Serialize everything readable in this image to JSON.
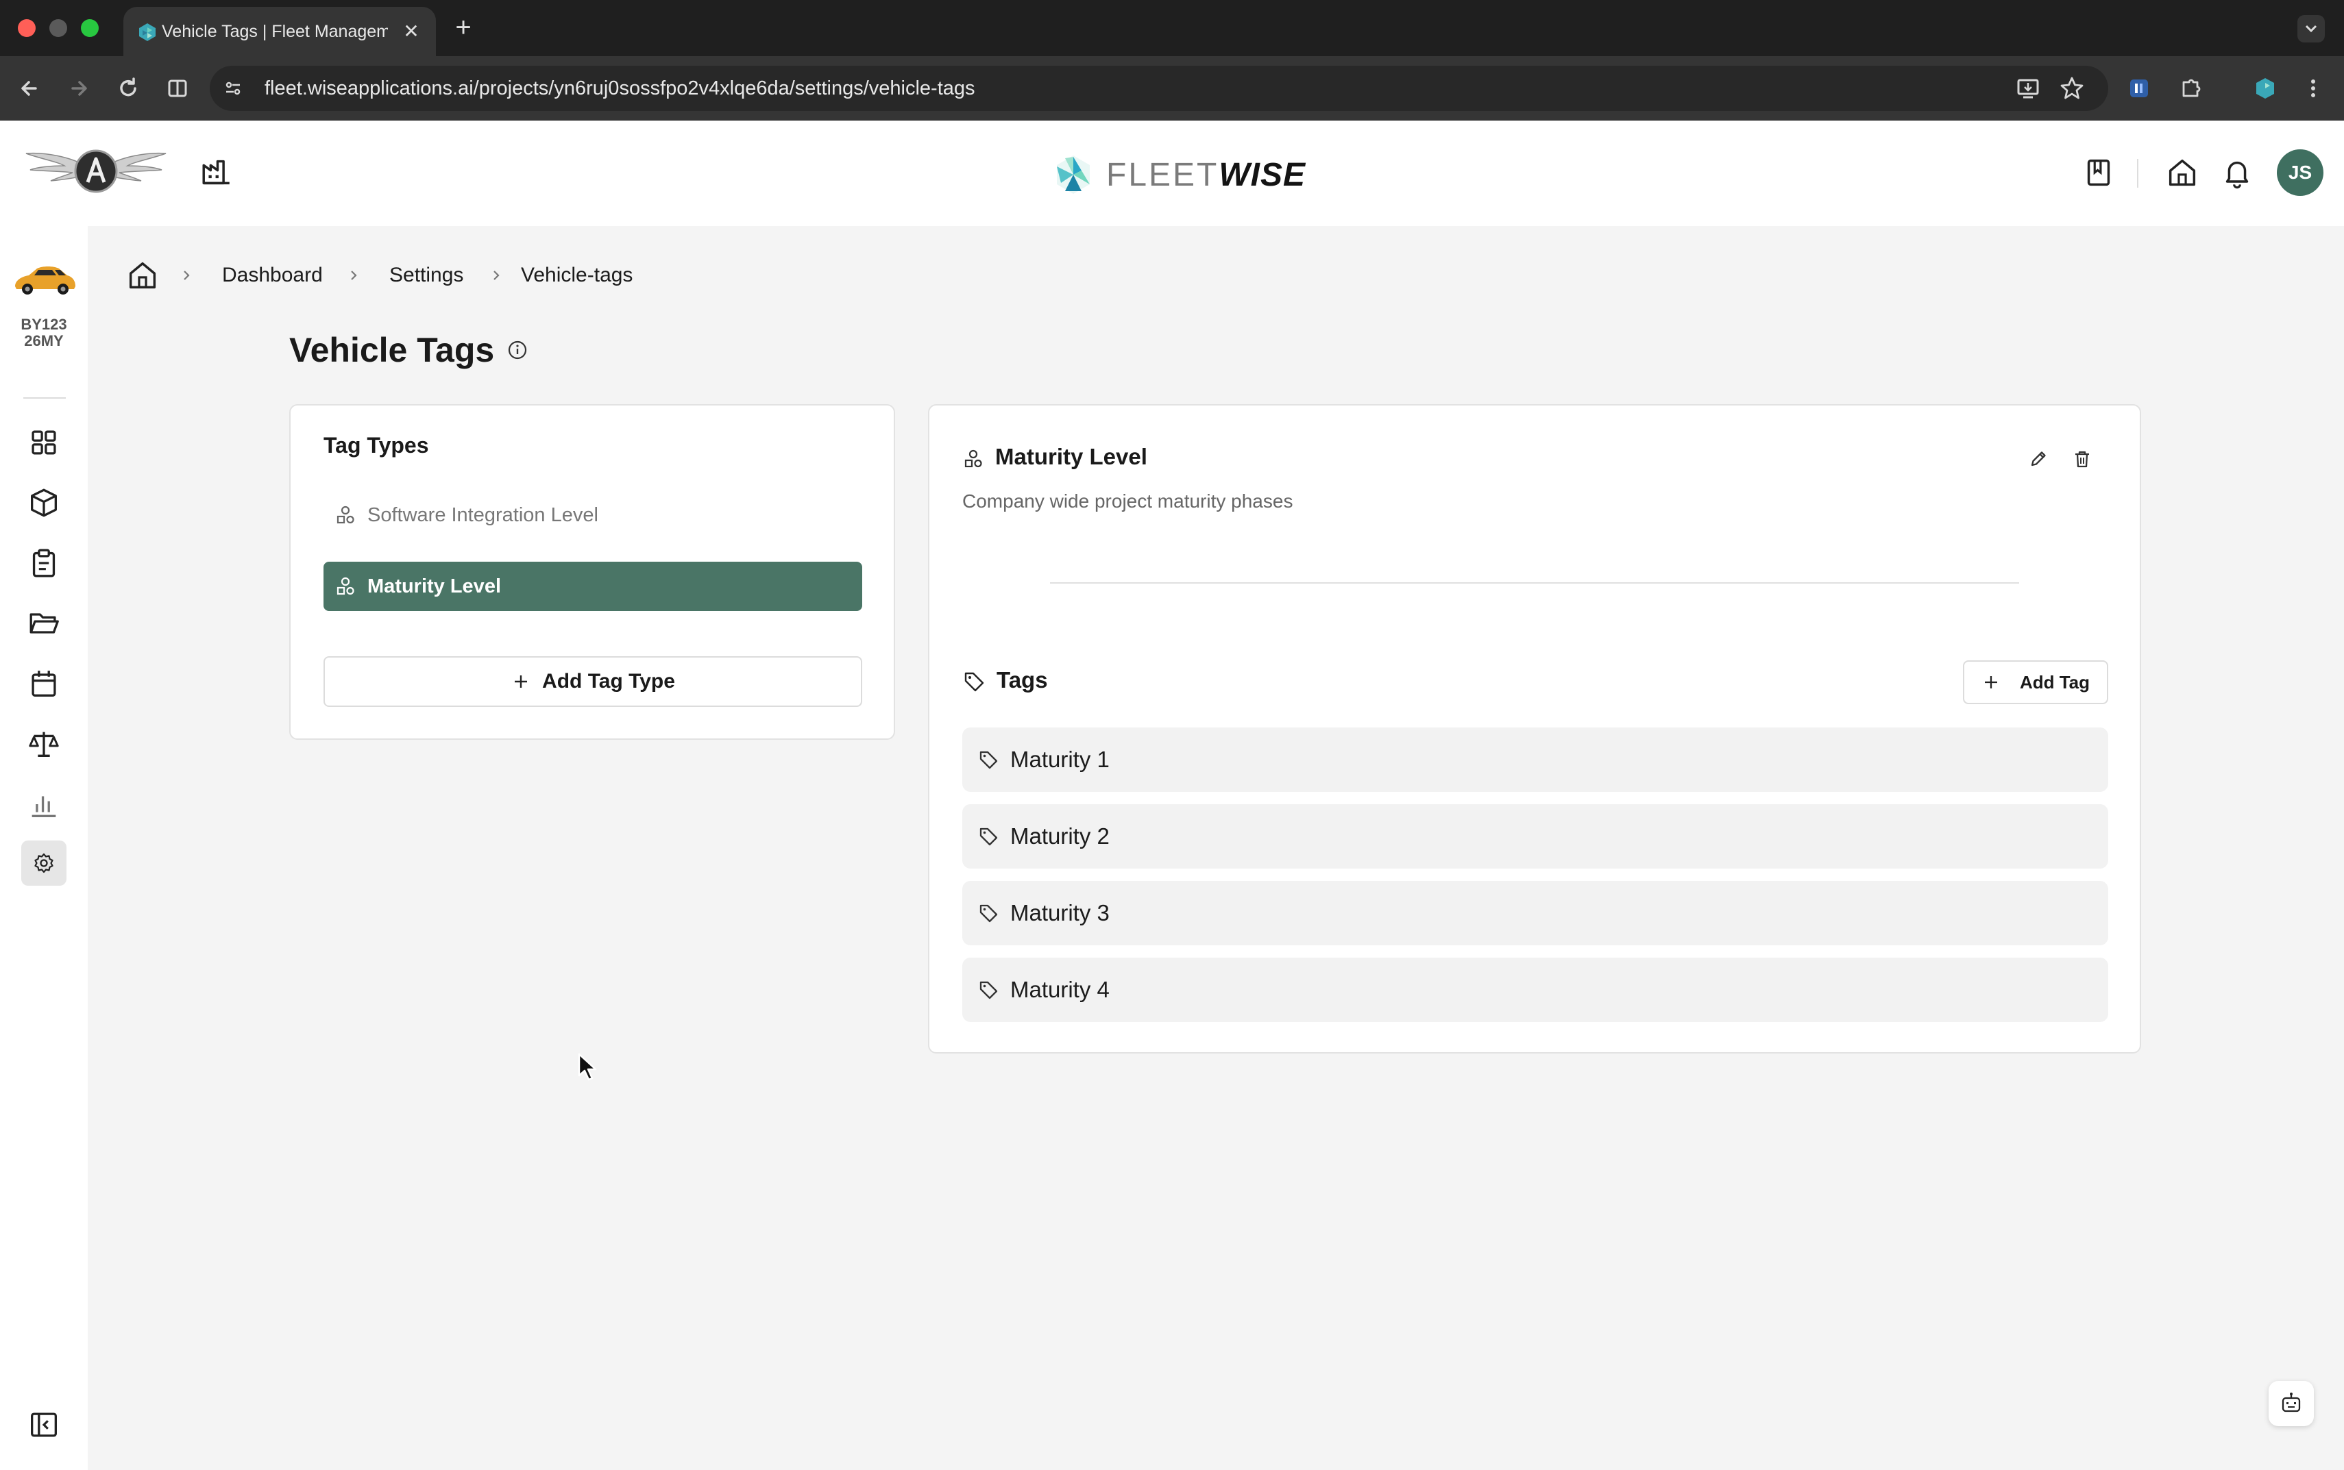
{
  "browser": {
    "tab_title": "Vehicle Tags | Fleet Managem",
    "url": "fleet.wiseapplications.ai/projects/yn6ruj0sossfpo2v4xlqe6da/settings/vehicle-tags",
    "traffic_colors": [
      "#ff5f57",
      "#5a5a5a",
      "#28c840"
    ]
  },
  "header": {
    "logo_word_light": "FLEET",
    "logo_word_bold": "WISE",
    "avatar_initials": "JS",
    "avatar_color": "#3f6f60"
  },
  "sidebar": {
    "vehicle_label_line1": "BY123",
    "vehicle_label_line2": "26MY",
    "items": [
      "dashboard-icon",
      "cube-icon",
      "clipboard-icon",
      "folder-icon",
      "calendar-icon",
      "scale-icon",
      "bar-chart-icon",
      "gear-icon"
    ],
    "active": "gear-icon"
  },
  "breadcrumb": {
    "items": [
      "Dashboard",
      "Settings",
      "Vehicle-tags"
    ]
  },
  "page": {
    "title": "Vehicle Tags"
  },
  "tag_types": {
    "heading": "Tag Types",
    "items": [
      {
        "label": "Software Integration Level",
        "selected": false
      },
      {
        "label": "Maturity Level",
        "selected": true
      }
    ],
    "add_label": "Add Tag Type"
  },
  "detail": {
    "title": "Maturity Level",
    "description": "Company wide project maturity phases",
    "tags_heading": "Tags",
    "add_tag_label": "Add Tag",
    "tags": [
      "Maturity 1",
      "Maturity 2",
      "Maturity 3",
      "Maturity 4"
    ]
  },
  "colors": {
    "accent": "#4a7566",
    "accent_text": "#ffffff"
  }
}
